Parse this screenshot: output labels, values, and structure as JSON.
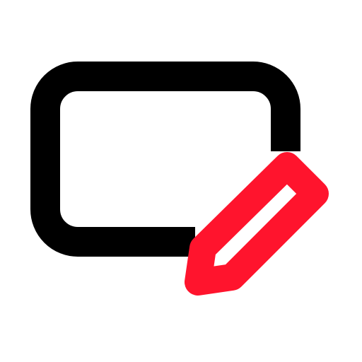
{
  "icon": {
    "name": "rectangle-edit-icon",
    "parts": [
      {
        "name": "rounded-rectangle-outline",
        "color": "#000000"
      },
      {
        "name": "pencil-icon",
        "color": "#FF142D"
      }
    ]
  }
}
